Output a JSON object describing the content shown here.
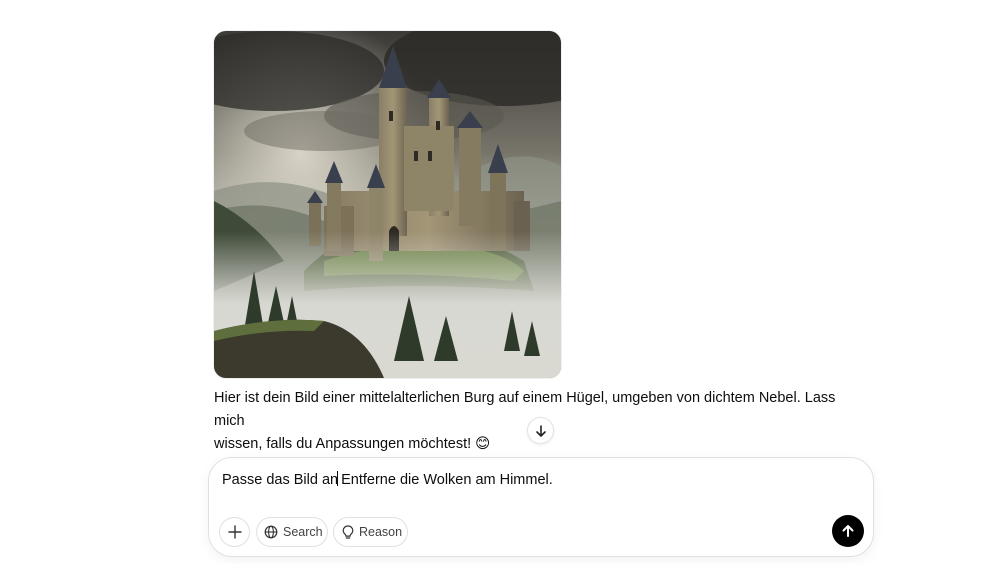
{
  "assistant": {
    "message_line1": "Hier ist dein Bild einer mittelalterlichen Burg auf einem Hügel, umgeben von dichtem Nebel. Lass mich",
    "message_line2": "wissen, falls du Anpassungen möchtest! ",
    "emoji": "😊"
  },
  "generated_image": {
    "subject": "castle-on-hill-in-fog"
  },
  "composer": {
    "text_before_caret": "Passe das Bild an",
    "text_after_caret": " Entferne die Wolken am Himmel.",
    "search_label": "Search",
    "reason_label": "Reason"
  },
  "icons": {
    "scroll": "arrow-down-icon",
    "plus": "plus-icon",
    "search": "globe-icon",
    "reason": "lightbulb-icon",
    "send": "arrow-up-icon"
  },
  "colors": {
    "send_button": "#000000",
    "border": "#e0e0e0"
  }
}
